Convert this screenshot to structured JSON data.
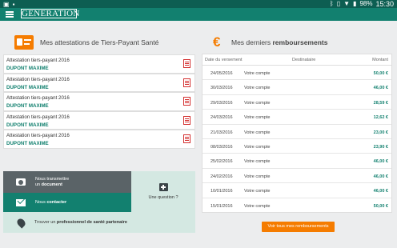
{
  "status_bar": {
    "left_icons": [
      "photo-icon",
      "generic-app-icon"
    ],
    "right_icons": [
      "bluetooth-icon",
      "vibrate-icon",
      "wifi-icon",
      "battery-icon"
    ],
    "battery": "98%",
    "time": "15:30"
  },
  "app_bar": {
    "logo": "GENERATION"
  },
  "attestations": {
    "title": "Mes attestations de Tiers-Payant Santé",
    "items": [
      {
        "title": "Attestation tiers-payant 2016",
        "name": "DUPONT MAXIME"
      },
      {
        "title": "Attestation tiers-payant 2016",
        "name": "DUPONT MAXIME"
      },
      {
        "title": "Attestation tiers-payant 2016",
        "name": "DUPONT MAXIME"
      },
      {
        "title": "Attestation tiers-payant 2016",
        "name": "DUPONT MAXIME"
      },
      {
        "title": "Attestation tiers-payant 2016",
        "name": "DUPONT MAXIME"
      }
    ]
  },
  "tiles": {
    "send_line1": "Nous transmettre",
    "send_line2_prefix": "un ",
    "send_line2_bold": "document",
    "contact_prefix": "Nous ",
    "contact_bold": "contacter",
    "question": "Une question ?",
    "find_prefix": "Trouver un ",
    "find_bold": "professionnel de santé partenaire"
  },
  "remboursements": {
    "title_prefix": "Mes derniers ",
    "title_bold": "remboursements",
    "headers": {
      "date": "Date du versement",
      "dest": "Destinataire",
      "amount": "Montant"
    },
    "rows": [
      {
        "date": "24/05/2016",
        "dest": "Votre compte",
        "amount": "50,00 €"
      },
      {
        "date": "30/03/2016",
        "dest": "Votre compte",
        "amount": "46,00 €"
      },
      {
        "date": "29/03/2016",
        "dest": "Votre compte",
        "amount": "28,59 €"
      },
      {
        "date": "24/03/2016",
        "dest": "Votre compte",
        "amount": "12,62 €"
      },
      {
        "date": "21/03/2016",
        "dest": "Votre compte",
        "amount": "23,00 €"
      },
      {
        "date": "08/03/2016",
        "dest": "Votre compte",
        "amount": "23,90 €"
      },
      {
        "date": "25/02/2016",
        "dest": "Votre compte",
        "amount": "46,00 €"
      },
      {
        "date": "24/02/2016",
        "dest": "Votre compte",
        "amount": "46,00 €"
      },
      {
        "date": "10/01/2016",
        "dest": "Votre compte",
        "amount": "46,00 €"
      },
      {
        "date": "15/01/2016",
        "dest": "Votre compte",
        "amount": "50,00 €"
      }
    ],
    "button": "Voir tous mes remboursements"
  },
  "colors": {
    "brand": "#12806f",
    "accent": "#f57c00"
  }
}
